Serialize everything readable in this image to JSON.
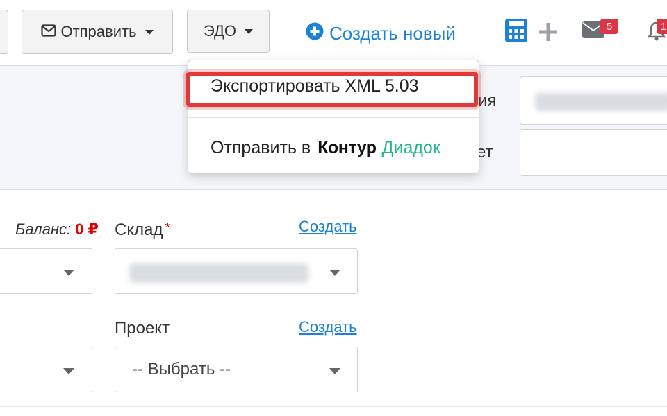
{
  "toolbar": {
    "send_label": "Отправить",
    "edo_label": "ЭДО",
    "create_new_label": "Создать новый",
    "mail_badge": "5",
    "notif_badge": "1",
    "accent_color": "#1b82d6"
  },
  "dropdown": {
    "items": [
      {
        "label": "Экспортировать XML 5.03",
        "highlighted": true
      },
      {
        "label": "Отправить в",
        "brand_part1": "Контур",
        "brand_part2": "Диадок"
      }
    ],
    "highlight_color": "#e23838",
    "brand_color": "#1fb58f"
  },
  "header": {
    "label_1_fragment": "ия",
    "label_2_fragment": "ет"
  },
  "form": {
    "balance_label": "Баланс:",
    "balance_value": "0 ₽",
    "warehouse_label": "Склад",
    "required_mark": "*",
    "warehouse_create_link": "Создать",
    "project_label": "Проект",
    "project_create_link": "Создать",
    "project_value": "-- Выбрать --"
  },
  "icons": {
    "envelope": "envelope-icon",
    "plus_circle": "plus-circle-icon",
    "calculator": "calculator-icon",
    "plus": "plus-icon",
    "mail": "mail-icon",
    "bell": "bell-icon",
    "caret_down": "caret-down-icon"
  }
}
